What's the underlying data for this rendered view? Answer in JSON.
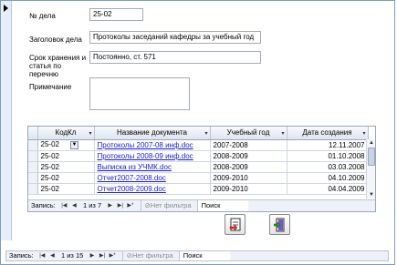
{
  "form": {
    "case_number_label": "№ дела",
    "case_number_value": "25-02",
    "title_label": "Заголовок дела",
    "title_value": "Протоколы заседаний кафедры за учебный год",
    "retention_label": "Срок хранения и статья по перечню",
    "retention_value": "Постоянно, ст. 571",
    "note_label": "Примечание",
    "note_value": ""
  },
  "subform": {
    "columns": [
      "КодКл",
      "Название документа",
      "Учебный год",
      "Дата создания"
    ],
    "rows": [
      {
        "code": "25-02",
        "name": "Протоколы 2007-08 инф.doc",
        "year": "2007-2008",
        "date": "12.11.2007"
      },
      {
        "code": "25-02",
        "name": "Протоколы 2008-09 инф.doc",
        "year": "2008-2009",
        "date": "01.10.2008"
      },
      {
        "code": "25-02",
        "name": "Выписка из УЧМК.doc",
        "year": "2008-2009",
        "date": "03.03.2008"
      },
      {
        "code": "25-02",
        "name": "Отчет2007-2008.doc",
        "year": "2009-2010",
        "date": "04.10.2009"
      },
      {
        "code": "25-02",
        "name": "Отчет2008-2009.doc",
        "year": "2009-2010",
        "date": "04.04.2009"
      }
    ],
    "nav": {
      "record_label": "Запись:",
      "counter": "1 из 7",
      "filter_label": "Нет фильтра",
      "search_label": "Поиск"
    }
  },
  "main_nav": {
    "record_label": "Запись:",
    "counter": "1 из 15",
    "filter_label": "Нет фильтра",
    "search_label": "Поиск"
  },
  "colors": {
    "link": "#1a1acc",
    "header_bg": "#dde5f0",
    "nav_bg": "#eef2f8"
  },
  "icons": [
    "nav-first-icon",
    "nav-prev-icon",
    "nav-next-icon",
    "nav-last-icon",
    "nav-new-icon",
    "filter-icon",
    "document-icon",
    "exit-door-icon",
    "combo-dropdown-icon",
    "sort-icon"
  ]
}
